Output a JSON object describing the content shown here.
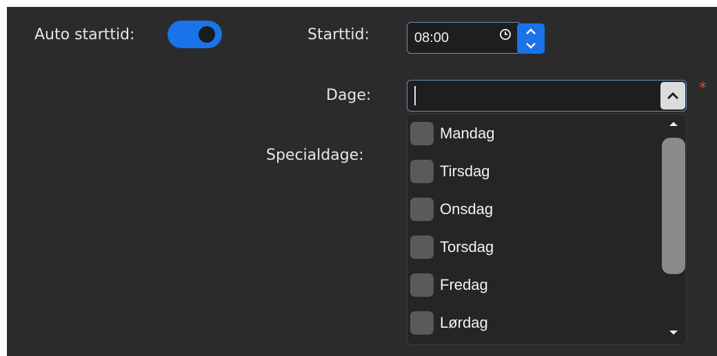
{
  "form": {
    "auto_starttid_label": "Auto starttid:",
    "auto_starttid_on": true,
    "starttid_label": "Starttid:",
    "starttid_value": "08:00",
    "dage_label": "Dage:",
    "dage_value": "",
    "required_mark": "*",
    "specialdage_label": "Specialdage:"
  },
  "dropdown": {
    "options": [
      {
        "label": "Mandag",
        "checked": false
      },
      {
        "label": "Tirsdag",
        "checked": false
      },
      {
        "label": "Onsdag",
        "checked": false
      },
      {
        "label": "Torsdag",
        "checked": false
      },
      {
        "label": "Fredag",
        "checked": false
      },
      {
        "label": "Lørdag",
        "checked": false
      }
    ]
  },
  "colors": {
    "background": "#2b2b2b",
    "accent": "#1a73e8",
    "required": "#d05030"
  }
}
